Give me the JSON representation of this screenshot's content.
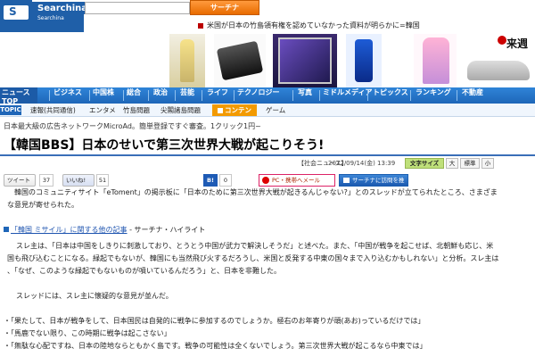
{
  "header": {
    "logo_text": "Searchina",
    "logo_mark": "S",
    "logo_subtitle": "Searchina",
    "search_placeholder": "",
    "search_button": "サーチナ",
    "top_news": "米国が日本の竹島領有権を認めていなかった資料が明らかに=韓国"
  },
  "promo": {
    "label": "来週"
  },
  "main_nav": [
    "ニュースTOP",
    "ビジネス",
    "中国株",
    "総合",
    "政治",
    "芸能",
    "ライフ",
    "テクノロジー",
    "写真",
    "ミドルメディア",
    "トピックス",
    "ランキング",
    "不動産"
  ],
  "sub_nav": {
    "topic": "TOPIC",
    "items": [
      "速報(共同通信)",
      "エンタメ",
      "竹島問題",
      "尖閣諸島問題"
    ],
    "content_label": "コンテンツ",
    "game": "ゲーム"
  },
  "ad_line": "日本最大級の広告ネットワークMicroAd。簡単登録ですぐ審査。1クリック1円~",
  "article": {
    "title": "【韓国BBS】日本のせいで第三次世界大戦が起こりそう!",
    "category": "【社会ニュース】",
    "date": "2012/09/14(金) 13:39",
    "text_size_label": "文字サイズ",
    "size_options": [
      "大",
      "標準",
      "小"
    ]
  },
  "social": {
    "tweet_label": "ツイート",
    "tweet_count": "37",
    "like_label": "いいね!",
    "like_count": "51",
    "bf_label": "B!",
    "bf_count": "0",
    "mobile_label": "PC・携帯へメール",
    "subscribe_label": "サーチナに訪問を推奨"
  },
  "paragraphs": {
    "intro_1": "韓国のコミュニティサイト「eToment」の掲示板に「日本のために第三次世界大戦が起きるんじゃない?」とのスレッドが立てられたところ、さまざま",
    "intro_2": "な意見が寄せられた。",
    "related_link": "「韓国 ミサイル」に関する他の記事",
    "related_source": " - サーチナ・ハイライト",
    "body1_1": "スレ主は、「日本は中国をしきりに刺激しており、とうとう中国が武力で解決しそうだ」と述べた。また、「中国が戦争を起こせば、北朝鮮も応じ、米",
    "body1_2": "国も飛び込むことになる。緑起でもないが、韓国にも当然飛び火するだろうし、米国と反発する中東の国々まで入り込むかもしれない」と分析。スレ主は",
    "body1_3": "、「なぜ、このような緑起でもないものが噴いているんだろう」と、日本を非難した。",
    "body2": "スレッドには、スレ主に懐疑的な意見が並んだ。"
  },
  "quotes": [
    "・「果たして、日本が戦争をして、日本国民は自発的に戦争に参加するのでしょうか。極右のお年寄りが頑(あお)っているだけでは」",
    "・「馬鹿でない限り、この時期に戦争は起こさない」",
    "・「無駄な心配ですね、日本の陸地ならともかく島です。戦争の可能性は全くないでしょう。第三次世界大戦が起こるなら中東では」"
  ],
  "colors": {
    "brand_blue": "#1f5fa8",
    "nav_blue": "#2f84d8",
    "search_orange": "#f07a10",
    "content_orange": "#f39a00",
    "text_size_green": "#bfe07a"
  }
}
